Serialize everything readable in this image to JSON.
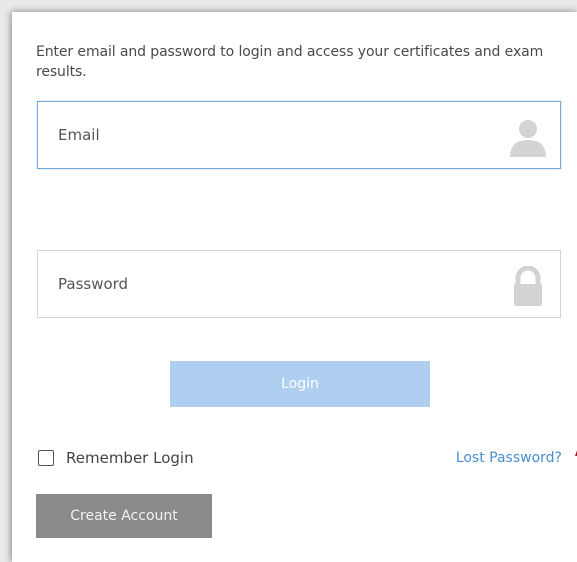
{
  "intro_text": "Enter email and password to login and access your certificates and exam results.",
  "email": {
    "value": "",
    "placeholder": "Email",
    "icon": "user-icon"
  },
  "password": {
    "value": "",
    "placeholder": "Password",
    "icon": "lock-icon"
  },
  "login_label": "Login",
  "remember": {
    "label": "Remember Login",
    "checked": false
  },
  "lost_password_label": "Lost Password?",
  "create_account_label": "Create Account",
  "colors": {
    "accent_focus": "#79a9d8",
    "login_button": "#aecff0",
    "link": "#4a8fcf",
    "create_button": "#8a8a8a",
    "icon_gray": "#d3d3d3",
    "pointer_red": "#a0141e"
  }
}
